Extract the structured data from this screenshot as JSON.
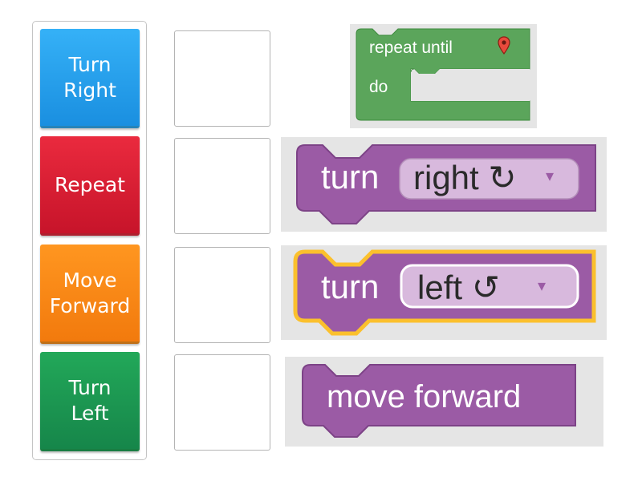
{
  "answers": [
    {
      "label": "Turn\nRight"
    },
    {
      "label": "Repeat"
    },
    {
      "label": "Move\nForward"
    },
    {
      "label": "Turn\nLeft"
    }
  ],
  "blocks": {
    "repeat": {
      "line1": "repeat until",
      "line2": "do",
      "icon": "map-pin-icon"
    },
    "turn_right": {
      "word": "turn",
      "option": "right ↻",
      "arrow": "▾"
    },
    "turn_left": {
      "word": "turn",
      "option": "left ↺",
      "arrow": "▾"
    },
    "move": {
      "label": "move forward"
    }
  },
  "colors": {
    "blue": "#1a8fe0",
    "red": "#d81b32",
    "orange": "#f88a16",
    "green": "#1c8e4f",
    "block_purple": "#9b5ba5",
    "block_green": "#5ba55b",
    "dropdown": "#d8b9dd",
    "highlight": "#fbc02d"
  }
}
